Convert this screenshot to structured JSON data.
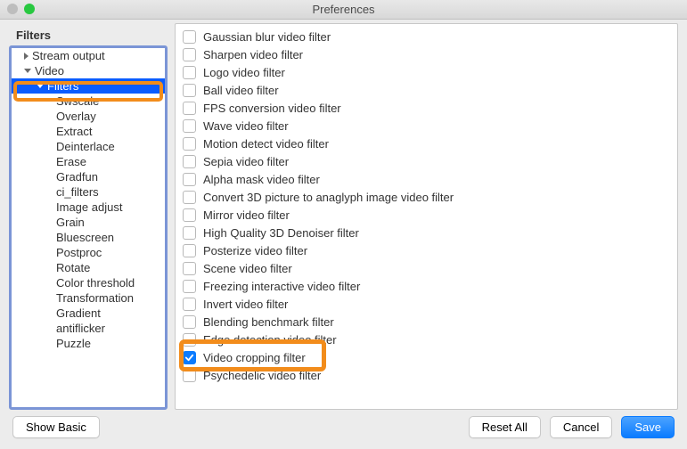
{
  "window": {
    "title": "Preferences"
  },
  "section_header": "Filters",
  "sidebar": {
    "items": [
      {
        "label": "Stream output",
        "level": 1,
        "caret": "right",
        "selected": false
      },
      {
        "label": "Video",
        "level": 1,
        "caret": "down",
        "selected": false
      },
      {
        "label": "Filters",
        "level": 2,
        "caret": "down",
        "selected": true
      },
      {
        "label": "Swscale",
        "level": 3,
        "caret": "",
        "selected": false
      },
      {
        "label": "Overlay",
        "level": 3,
        "caret": "",
        "selected": false
      },
      {
        "label": "Extract",
        "level": 3,
        "caret": "",
        "selected": false
      },
      {
        "label": "Deinterlace",
        "level": 3,
        "caret": "",
        "selected": false
      },
      {
        "label": "Erase",
        "level": 3,
        "caret": "",
        "selected": false
      },
      {
        "label": "Gradfun",
        "level": 3,
        "caret": "",
        "selected": false
      },
      {
        "label": "ci_filters",
        "level": 3,
        "caret": "",
        "selected": false
      },
      {
        "label": "Image adjust",
        "level": 3,
        "caret": "",
        "selected": false
      },
      {
        "label": "Grain",
        "level": 3,
        "caret": "",
        "selected": false
      },
      {
        "label": "Bluescreen",
        "level": 3,
        "caret": "",
        "selected": false
      },
      {
        "label": "Postproc",
        "level": 3,
        "caret": "",
        "selected": false
      },
      {
        "label": "Rotate",
        "level": 3,
        "caret": "",
        "selected": false
      },
      {
        "label": "Color threshold",
        "level": 3,
        "caret": "",
        "selected": false
      },
      {
        "label": "Transformation",
        "level": 3,
        "caret": "",
        "selected": false
      },
      {
        "label": "Gradient",
        "level": 3,
        "caret": "",
        "selected": false
      },
      {
        "label": "antiflicker",
        "level": 3,
        "caret": "",
        "selected": false
      },
      {
        "label": "Puzzle",
        "level": 3,
        "caret": "",
        "selected": false
      }
    ]
  },
  "filters": [
    {
      "label": "Gaussian blur video filter",
      "checked": false
    },
    {
      "label": "Sharpen video filter",
      "checked": false
    },
    {
      "label": "Logo video filter",
      "checked": false
    },
    {
      "label": "Ball video filter",
      "checked": false
    },
    {
      "label": "FPS conversion video filter",
      "checked": false
    },
    {
      "label": "Wave video filter",
      "checked": false
    },
    {
      "label": "Motion detect video filter",
      "checked": false
    },
    {
      "label": "Sepia video filter",
      "checked": false
    },
    {
      "label": "Alpha mask video filter",
      "checked": false
    },
    {
      "label": "Convert 3D picture to anaglyph image video filter",
      "checked": false
    },
    {
      "label": "Mirror video filter",
      "checked": false
    },
    {
      "label": "High Quality 3D Denoiser filter",
      "checked": false
    },
    {
      "label": "Posterize video filter",
      "checked": false
    },
    {
      "label": "Scene video filter",
      "checked": false
    },
    {
      "label": "Freezing interactive video filter",
      "checked": false
    },
    {
      "label": "Invert video filter",
      "checked": false
    },
    {
      "label": "Blending benchmark filter",
      "checked": false
    },
    {
      "label": "Edge detection video filter",
      "checked": false
    },
    {
      "label": "Video cropping filter",
      "checked": true
    },
    {
      "label": "Psychedelic video filter",
      "checked": false
    }
  ],
  "highlight": {
    "filter_index": 18
  },
  "buttons": {
    "show_basic": "Show Basic",
    "reset_all": "Reset All",
    "cancel": "Cancel",
    "save": "Save"
  }
}
